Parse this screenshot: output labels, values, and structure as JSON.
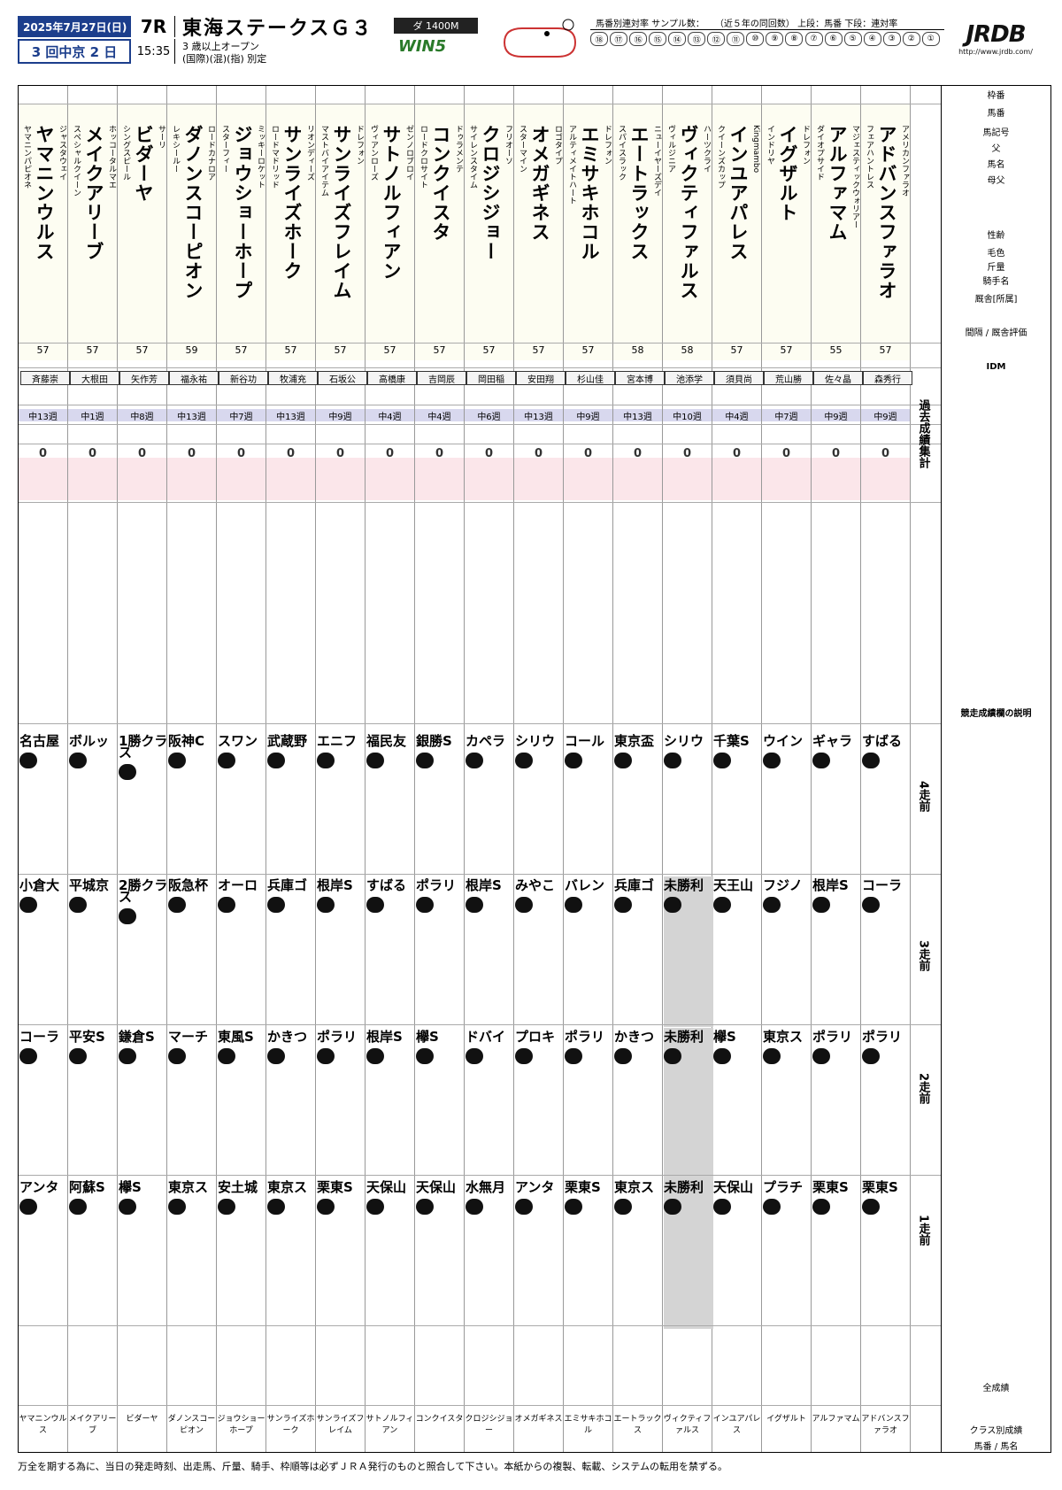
{
  "header": {
    "date": "2025年7月27日(日)",
    "meeting": "3 回中京 2 日",
    "race_no": "7R",
    "post_time": "15:35",
    "title": "東海ステークスＧ３",
    "conditions_1": "3 歳以上オープン",
    "conditions_2": "(国際)(混)(指) 別定",
    "distance": "ダ 1400M",
    "win5": "WIN5",
    "sample_label": "馬番別連対率 サンプル数：",
    "sample_note": "（近５年の同回数） 上段：馬番 下段：連対率",
    "logo": "JRDB",
    "logo_url": "http://www.jrdb.com/"
  },
  "horses": [
    {
      "name": "ヤマニンウルス",
      "sire": "ジャスタウェイ",
      "dam": "ヤマニンパピオネ",
      "wt": "57",
      "jockey": "斉藤崇",
      "week": "中13週",
      "idm": "0"
    },
    {
      "name": "メイクアリーブ",
      "sire": "ホッコータルマエ",
      "dam": "スペシャルクイーン",
      "wt": "57",
      "jockey": "大根田",
      "week": "中1週",
      "idm": "0"
    },
    {
      "name": "ビダーヤ",
      "sire": "サーリ",
      "dam": "シングスピール",
      "wt": "57",
      "jockey": "矢作芳",
      "week": "中8週",
      "idm": "0"
    },
    {
      "name": "ダノンスコーピオン",
      "sire": "ロードカナロア",
      "dam": "レキシールー",
      "wt": "59",
      "jockey": "福永祐",
      "week": "中13週",
      "idm": "0"
    },
    {
      "name": "ジョウショーホープ",
      "sire": "ミッキーロケット",
      "dam": "スターフィー",
      "wt": "57",
      "jockey": "新谷功",
      "week": "中7週",
      "idm": "0"
    },
    {
      "name": "サンライズホーク",
      "sire": "リオンディーズ",
      "dam": "ロードマドリッド",
      "wt": "57",
      "jockey": "牧浦充",
      "week": "中13週",
      "idm": "0"
    },
    {
      "name": "サンライズフレイム",
      "sire": "ドレフォン",
      "dam": "マストバイアイテム",
      "wt": "57",
      "jockey": "石坂公",
      "week": "中9週",
      "idm": "0"
    },
    {
      "name": "サトノルフィアン",
      "sire": "ゼンノロブロイ",
      "dam": "ヴィアンローズ",
      "wt": "57",
      "jockey": "高橋康",
      "week": "中4週",
      "idm": "0"
    },
    {
      "name": "コンクイスタ",
      "sire": "ドゥラメンテ",
      "dam": "ロードクロサイト",
      "wt": "57",
      "jockey": "吉岡辰",
      "week": "中4週",
      "idm": "0"
    },
    {
      "name": "クロジシジョー",
      "sire": "フリオーソ",
      "dam": "サイレンスタイム",
      "wt": "57",
      "jockey": "岡田稲",
      "week": "中6週",
      "idm": "0"
    },
    {
      "name": "オメガギネス",
      "sire": "ロゴタイプ",
      "dam": "スターマイン",
      "wt": "57",
      "jockey": "安田翔",
      "week": "中13週",
      "idm": "0"
    },
    {
      "name": "エミサキホコル",
      "sire": "ドレフォン",
      "dam": "アルティメイトハート",
      "wt": "57",
      "jockey": "杉山佳",
      "week": "中9週",
      "idm": "0"
    },
    {
      "name": "エートラックス",
      "sire": "ニューイヤーズデイ",
      "dam": "スパイスラック",
      "wt": "58",
      "jockey": "宮本博",
      "week": "中13週",
      "idm": "0"
    },
    {
      "name": "ヴィクティファルス",
      "sire": "ハーツクライ",
      "dam": "ヴィルジニア",
      "wt": "58",
      "jockey": "池添学",
      "week": "中10週",
      "idm": "0"
    },
    {
      "name": "インユアパレス",
      "sire": "Kingmambo",
      "dam": "クイーンズカップ",
      "wt": "57",
      "jockey": "須貝尚",
      "week": "中4週",
      "idm": "0"
    },
    {
      "name": "イグザルト",
      "sire": "ドレフォン",
      "dam": "インドリヤ",
      "wt": "57",
      "jockey": "荒山勝",
      "week": "中7週",
      "idm": "0"
    },
    {
      "name": "アルファマム",
      "sire": "マジェスティックウォリアー",
      "dam": "ダイオプサイド",
      "wt": "55",
      "jockey": "佐々晶",
      "week": "中9週",
      "idm": "0"
    },
    {
      "name": "アドバンスファラオ",
      "sire": "アメリカンファラオ",
      "dam": "フェアハントレス",
      "wt": "57",
      "jockey": "森秀行",
      "week": "中9週",
      "idm": "0"
    }
  ],
  "recent": [
    {
      "label": "4走前",
      "races": [
        "名古屋",
        "ボルッ",
        "1勝クラス",
        "阪神C",
        "スワン",
        "武蔵野",
        "エニフ",
        "福民友",
        "銀勝S",
        "カペラ",
        "シリウ",
        "コール",
        "東京盃",
        "シリウ",
        "千葉S",
        "ウイン",
        "ギャラ",
        "すばる"
      ]
    },
    {
      "label": "3走前",
      "races": [
        "小倉大",
        "平城京",
        "2勝クラス",
        "阪急杯",
        "オーロ",
        "兵庫ゴ",
        "根岸S",
        "すばる",
        "ポラリ",
        "根岸S",
        "みやこ",
        "バレン",
        "兵庫ゴ",
        "未勝利",
        "天王山",
        "フジノ",
        "根岸S",
        "コーラ"
      ]
    },
    {
      "label": "2走前",
      "races": [
        "コーラ",
        "平安S",
        "鎌倉S",
        "マーチ",
        "東風S",
        "かきつ",
        "ポラリ",
        "根岸S",
        "欅S",
        "ドバイ",
        "プロキ",
        "ポラリ",
        "かきつ",
        "未勝利",
        "欅S",
        "東京ス",
        "ポラリ",
        "ポラリ"
      ]
    },
    {
      "label": "1走前",
      "races": [
        "アンタ",
        "阿蘇S",
        "欅S",
        "東京ス",
        "安土城",
        "東京ス",
        "栗東S",
        "天保山",
        "天保山",
        "水無月",
        "アンタ",
        "栗東S",
        "東京ス",
        "未勝利",
        "天保山",
        "プラチ",
        "栗東S",
        "栗東S"
      ]
    }
  ],
  "labels": {
    "waku": "枠番",
    "umaban": "馬番",
    "symbol": "馬記号",
    "father": "父",
    "mother": "母",
    "horse_name": "馬名",
    "dam_sire": "母父",
    "age": "性齢",
    "color": "毛色",
    "weight": "斤量",
    "jockey": "騎手名",
    "trainer": "厩舎[所属]",
    "rest": "間隔 / 厩舎評価",
    "idm": "IDM",
    "past": "過去成績集計",
    "race_card": "競走成績欄の説明",
    "overall": "全成績",
    "total": "クラス別成績",
    "short_name": "馬番 / 馬名"
  },
  "disclaimer": "万全を期する為に、当日の発走時刻、出走馬、斤量、騎手、枠順等は必ずＪＲＡ発行のものと照合して下さい。本紙からの複製、転載、システムの転用を禁ずる。"
}
